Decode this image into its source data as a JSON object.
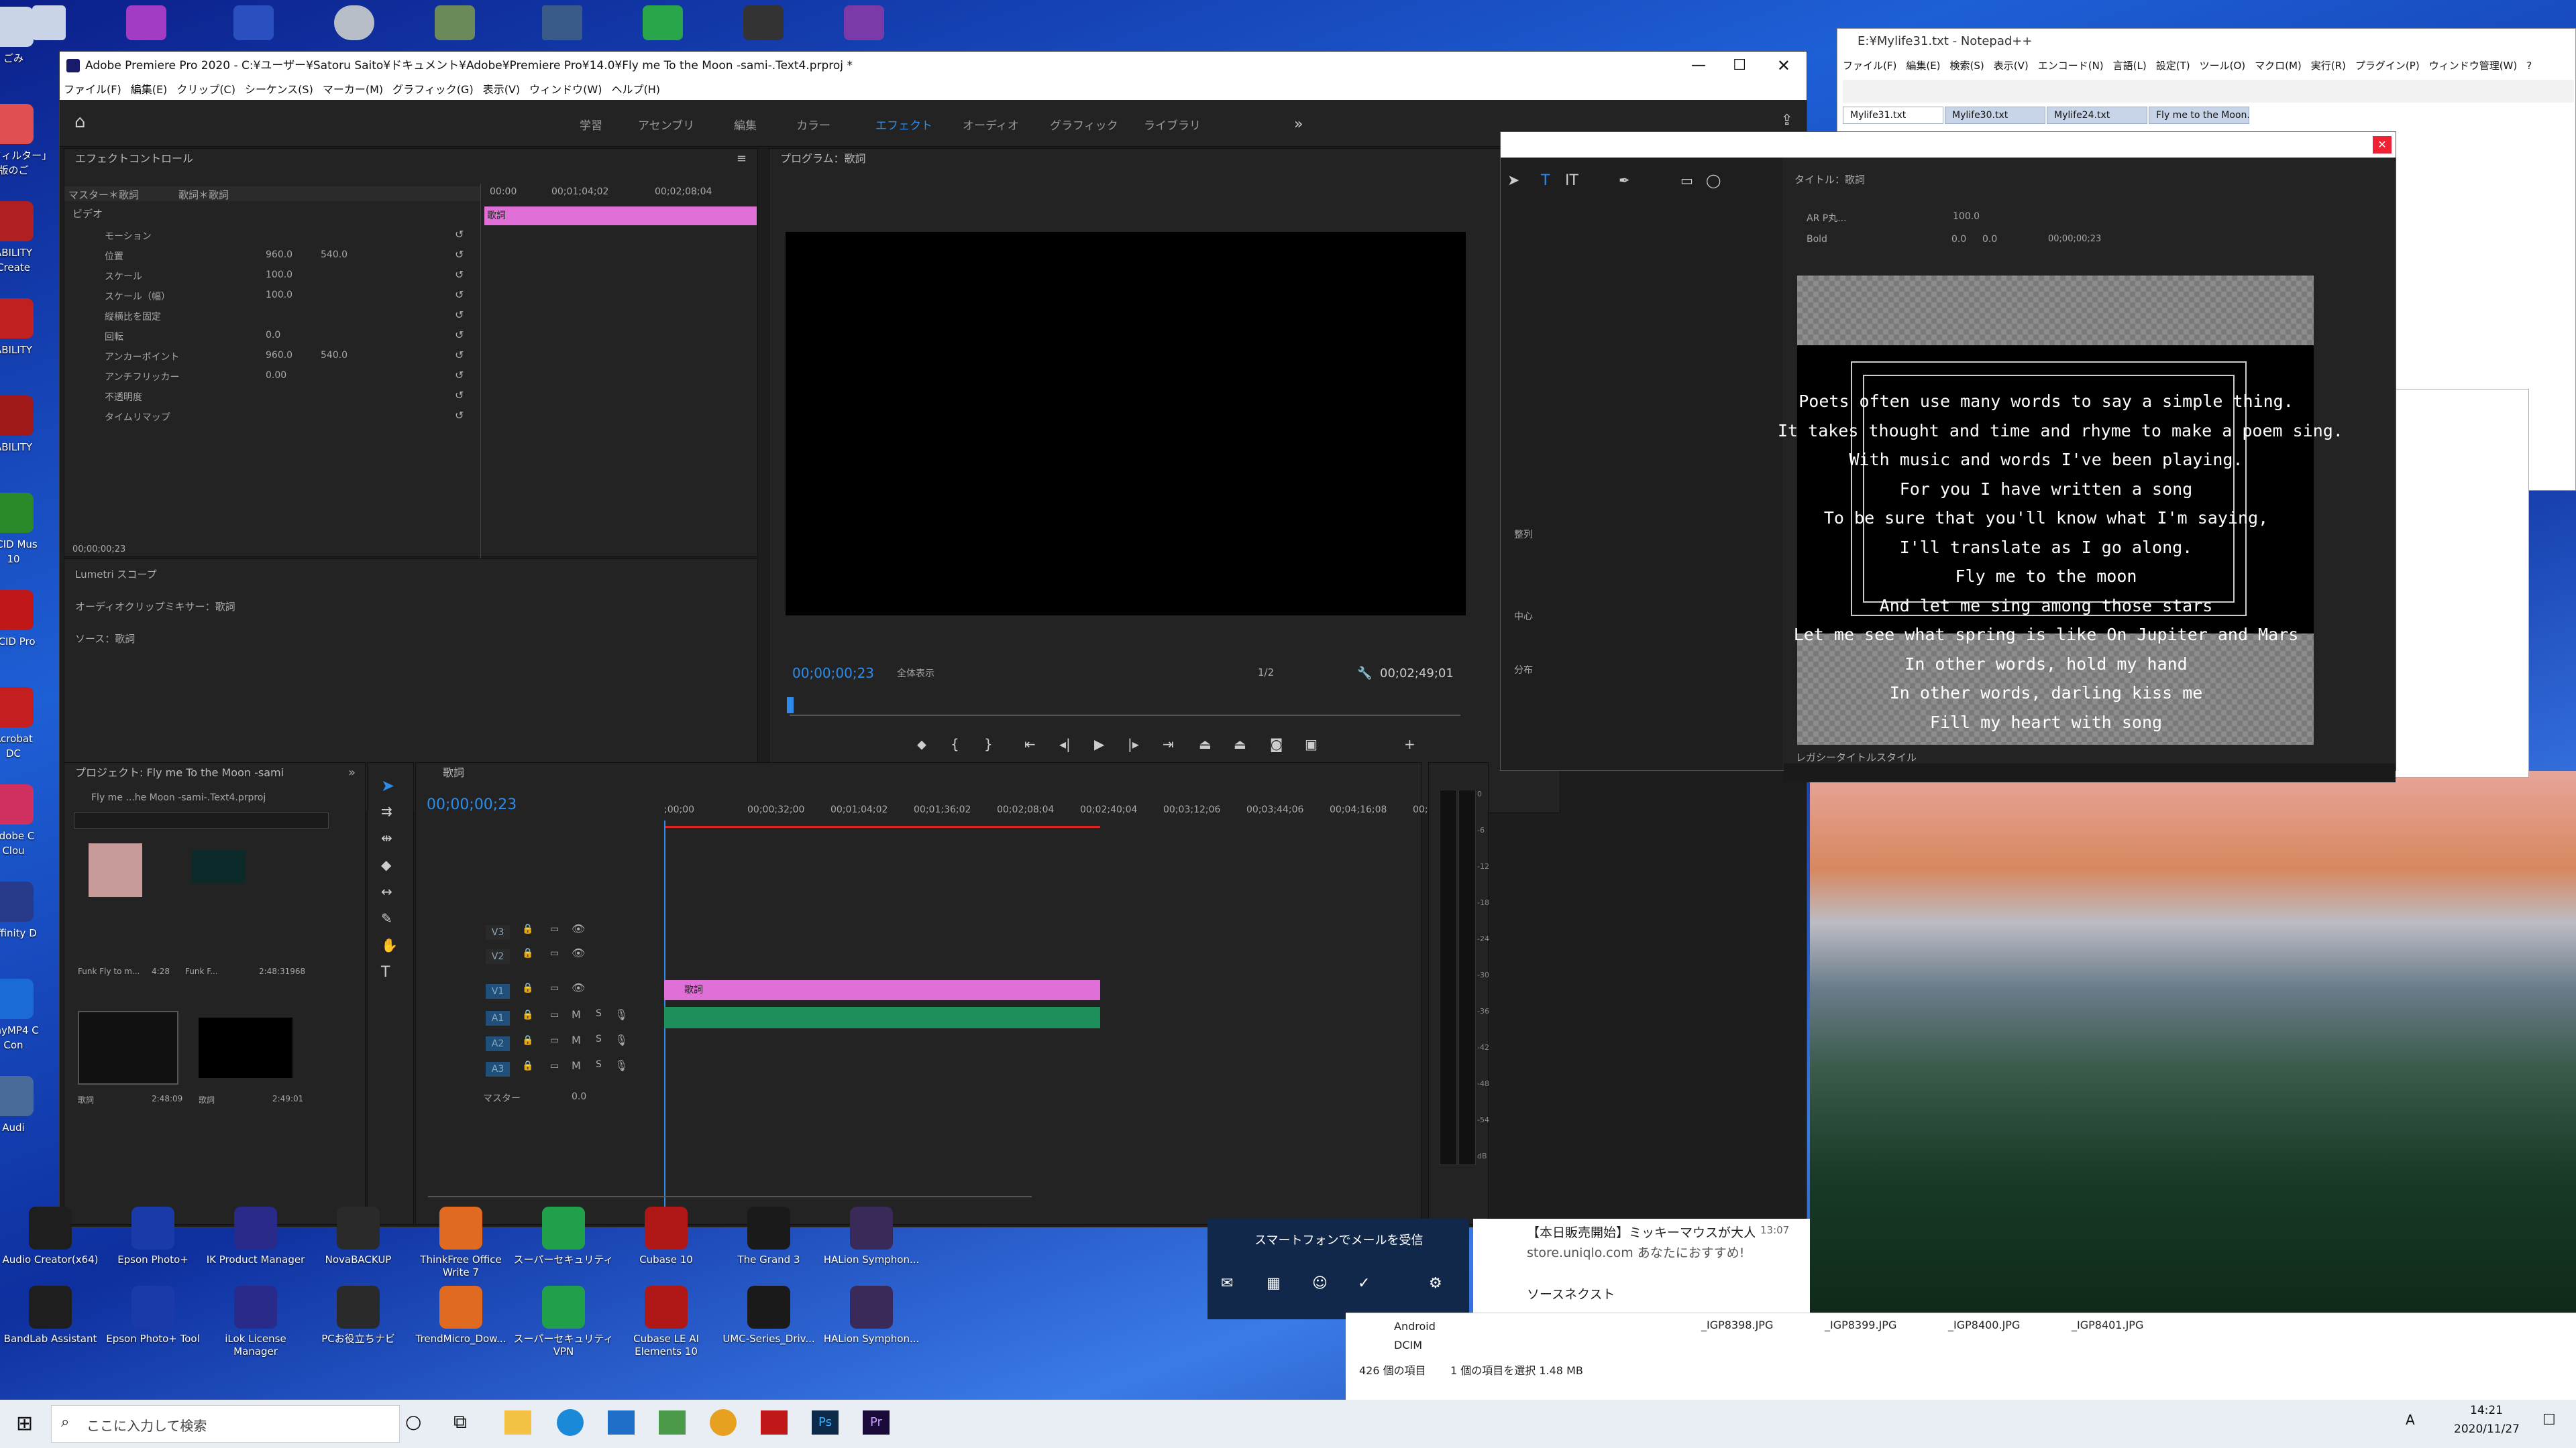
{
  "premiere": {
    "title": "Adobe Premiere Pro 2020 - C:¥ユーザー¥Satoru Saito¥ドキュメント¥Adobe¥Premiere Pro¥14.0¥Fly me To the Moon -sami-.Text4.prproj *",
    "menu": [
      "ファイル(F)",
      "編集(E)",
      "クリップ(C)",
      "シーケンス(S)",
      "マーカー(M)",
      "グラフィック(G)",
      "表示(V)",
      "ウィンドウ(W)",
      "ヘルプ(H)"
    ],
    "workspaces": [
      "学習",
      "アセンブリ",
      "編集",
      "カラー",
      "エフェクト",
      "オーディオ",
      "グラフィック",
      "ライブラリ"
    ],
    "active_workspace": "エフェクト",
    "effect_controls": {
      "title": "エフェクトコントロール",
      "master": "マスター＊歌詞",
      "clip": "歌詞＊歌詞",
      "ruler": [
        "00:00",
        "00;01;04;02",
        "00;02;08;04"
      ],
      "clip_label": "歌詞",
      "video": "ビデオ",
      "rows": [
        {
          "name": "モーション",
          "v1": "",
          "v2": ""
        },
        {
          "name": "位置",
          "v1": "960.0",
          "v2": "540.0"
        },
        {
          "name": "スケール",
          "v1": "100.0",
          "v2": ""
        },
        {
          "name": "スケール（幅）",
          "v1": "100.0",
          "v2": ""
        },
        {
          "name": "縦横比を固定",
          "v1": "",
          "v2": ""
        },
        {
          "name": "回転",
          "v1": "0.0",
          "v2": ""
        },
        {
          "name": "アンカーポイント",
          "v1": "960.0",
          "v2": "540.0"
        },
        {
          "name": "アンチフリッカー",
          "v1": "0.00",
          "v2": ""
        },
        {
          "name": "不透明度",
          "v1": "",
          "v2": ""
        },
        {
          "name": "タイムリマップ",
          "v1": "",
          "v2": ""
        }
      ],
      "time": "00;00;00;23"
    },
    "side_panels": [
      "Lumetri スコープ",
      "オーディオクリップミキサー：歌詞",
      "ソース：歌詞"
    ],
    "program": {
      "title": "プログラム：歌詞",
      "timecode": "00;00;00;23",
      "fit": "全体表示",
      "quality": "1/2",
      "duration": "00;02;49;01"
    },
    "project": {
      "title": "プロジェクト: Fly me To the Moon -sami",
      "file": "Fly me ...he Moon -sami-.Text4.prproj",
      "items": [
        {
          "name": "Funk Fly to m...",
          "dur": "4:28"
        },
        {
          "name": "Funk F...",
          "dur": "2:48:31968"
        },
        {
          "name": "歌詞",
          "dur": "2:48:09"
        },
        {
          "name": "歌詞",
          "dur": "2:49:01"
        }
      ]
    },
    "timeline": {
      "title": "歌詞",
      "timecode": "00;00;00;23",
      "ruler": [
        ";00;00",
        "00;00;32;00",
        "00;01;04;02",
        "00;01;36;02",
        "00;02;08;04",
        "00;02;40;04",
        "00;03;12;06",
        "00;03;44;06",
        "00;04;16;08",
        "00;0"
      ],
      "tracks": [
        "V3",
        "V2",
        "V1",
        "A1",
        "A2",
        "A3"
      ],
      "master": "マスター",
      "master_val": "0.0",
      "clip": "歌詞",
      "meter": [
        "0",
        "-6",
        "-12",
        "-18",
        "-24",
        "-30",
        "-36",
        "-42",
        "-48",
        "-54",
        "dB"
      ]
    }
  },
  "notepad": {
    "title": "E:¥Mylife31.txt - Notepad++",
    "menu": [
      "ファイル(F)",
      "編集(E)",
      "検索(S)",
      "表示(V)",
      "エンコード(N)",
      "言語(L)",
      "設定(T)",
      "ツール(O)",
      "マクロ(M)",
      "実行(R)",
      "プラグイン(P)",
      "ウィンドウ管理(W)",
      "?"
    ],
    "tabs": [
      "Mylife31.txt",
      "Mylife30.txt",
      "Mylife24.txt",
      "Fly me to the Moon.txt"
    ]
  },
  "titler": {
    "panel_title": "タイトル：歌詞",
    "font": "AR P丸...",
    "style": "Bold",
    "size": "100.0",
    "kern": "0.0",
    "leading": "0.0",
    "time": "00;00;00;23",
    "align_label": "整列",
    "center_label": "中心",
    "dist_label": "分布",
    "styles_label": "レガシータイトルスタイル",
    "lyrics": [
      "Poets often use many words to say a simple thing.",
      "It takes thought and time and rhyme to make a poem sing.",
      "With music and words I've been playing.",
      "For you I have written a song",
      "To be sure that you'll know what I'm saying,",
      "I'll translate as I go along.",
      "Fly me to the moon",
      "And let me sing among those stars",
      "Let me see what spring is like On Jupiter and Mars",
      "In other words, hold my hand",
      "In other words, darling kiss me",
      "Fill my heart with song"
    ]
  },
  "desktop_icons": [
    {
      "label": "ごみ",
      "row": 0
    },
    {
      "label": "「i-フィルター」\n版のご",
      "row": 1
    },
    {
      "label": "ABILITY\nCreate",
      "row": 2
    },
    {
      "label": "ABILITY",
      "row": 3
    },
    {
      "label": "ABILITY",
      "row": 4
    },
    {
      "label": "ACID Mus\n10",
      "row": 5
    },
    {
      "label": "ACID Pro",
      "row": 6
    },
    {
      "label": "Acrobat\nDC",
      "row": 7
    },
    {
      "label": "Adobe C\nClou",
      "row": 8
    },
    {
      "label": "Affinity D",
      "row": 9
    },
    {
      "label": "AnyMP4 C\nCon",
      "row": 10
    },
    {
      "label": "Audi",
      "row": 11
    }
  ],
  "bottom_icons": [
    {
      "label": "Audio Creator(x64)"
    },
    {
      "label": "Epson Photo+"
    },
    {
      "label": "IK Product Manager"
    },
    {
      "label": "NovaBACKUP"
    },
    {
      "label": "ThinkFree Office Write 7"
    },
    {
      "label": "スーパーセキュリティ"
    },
    {
      "label": "Cubase 10"
    },
    {
      "label": "The Grand 3"
    },
    {
      "label": "HALion Symphon..."
    },
    {
      "label": "BandLab Assistant"
    },
    {
      "label": "Epson Photo+ Tool"
    },
    {
      "label": "iLok License Manager"
    },
    {
      "label": "PCお役立ちナビ"
    },
    {
      "label": "TrendMicro_Dow..."
    },
    {
      "label": "スーパーセキュリティ VPN"
    },
    {
      "label": "Cubase LE AI Elements 10"
    },
    {
      "label": "UMC-Series_Driv..."
    },
    {
      "label": "HALion Symphon..."
    }
  ],
  "mail": {
    "label": "スマートフォンでメールを受信"
  },
  "notif": {
    "title": "【本日販売開始】ミッキーマウスが大人",
    "time": "13:07",
    "sub": "store.uniqlo.com あなたにおすすめ!",
    "title2": "ソースネクスト"
  },
  "explorer": {
    "folders": [
      "Android",
      "DCIM"
    ],
    "status": "426 個の項目",
    "selected": "1 個の項目を選択  1.48 MB",
    "files": [
      "_IGP8398.JPG",
      "_IGP8399.JPG",
      "_IGP8400.JPG",
      "_IGP8401.JPG"
    ]
  },
  "taskbar": {
    "search": "ここに入力して検索",
    "time": "14:21",
    "date": "2020/11/27",
    "ime": "A"
  }
}
